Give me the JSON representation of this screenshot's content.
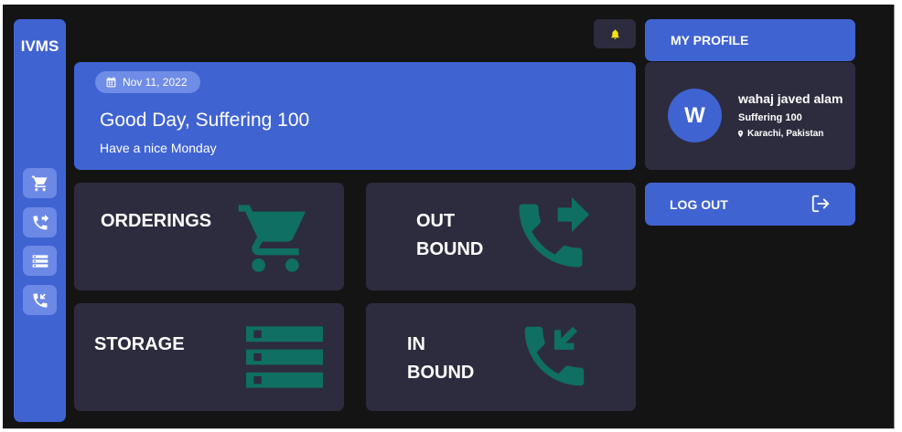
{
  "sidebar": {
    "brand": "IVMS",
    "items": [
      {
        "icon": "cart-icon"
      },
      {
        "icon": "phone-outbound-icon"
      },
      {
        "icon": "storage-icon"
      },
      {
        "icon": "phone-inbound-icon"
      }
    ]
  },
  "header": {
    "bell_icon": "bell-icon",
    "bell_color": "#f5e11a"
  },
  "banner": {
    "date": "Nov 11, 2022",
    "greeting": "Good Day, Suffering 100",
    "subtext": "Have a nice Monday"
  },
  "tiles": {
    "orderings": {
      "label": "ORDERINGS",
      "icon": "cart-icon"
    },
    "outbound": {
      "label_line1": "OUT",
      "label_line2": "BOUND",
      "icon": "phone-outbound-icon"
    },
    "storage": {
      "label": "STORAGE",
      "icon": "storage-icon"
    },
    "inbound": {
      "label_line1": "IN",
      "label_line2": "BOUND",
      "icon": "phone-inbound-icon"
    }
  },
  "profile": {
    "button_label": "MY PROFILE",
    "avatar_letter": "W",
    "name": "wahaj javed alam",
    "org": "Suffering 100",
    "location": "Karachi, Pakistan",
    "logout_label": "LOG OUT"
  },
  "colors": {
    "accent": "#4063d2",
    "accent_light": "#6c89e6",
    "card": "#2d2c3e",
    "background": "#141414",
    "icon_teal": "#0f6f62"
  }
}
